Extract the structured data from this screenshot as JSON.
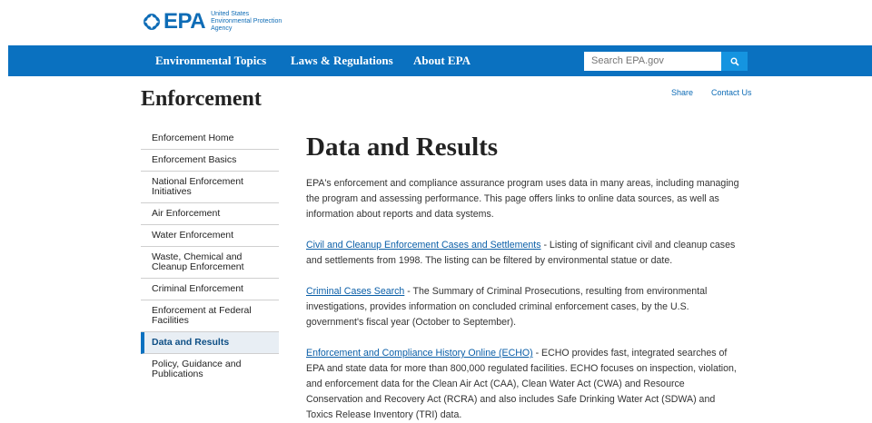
{
  "logo": {
    "text": "EPA",
    "sub": [
      "United States",
      "Environmental Protection",
      "Agency"
    ]
  },
  "nav": {
    "items": [
      "Environmental Topics",
      "Laws & Regulations",
      "About EPA"
    ],
    "search_placeholder": "Search EPA.gov",
    "search_icon": "search-icon"
  },
  "header": {
    "section_title": "Enforcement",
    "share": "Share",
    "contact": "Contact Us"
  },
  "sidebar": {
    "items": [
      {
        "label": "Enforcement Home"
      },
      {
        "label": "Enforcement Basics"
      },
      {
        "label": "National Enforcement Initiatives"
      },
      {
        "label": "Air Enforcement"
      },
      {
        "label": "Water Enforcement"
      },
      {
        "label": "Waste, Chemical and Cleanup Enforcement"
      },
      {
        "label": "Criminal Enforcement"
      },
      {
        "label": "Enforcement at Federal Facilities"
      },
      {
        "label": "Data and Results",
        "active": true
      },
      {
        "label": "Policy, Guidance and Publications"
      }
    ]
  },
  "main": {
    "title": "Data and Results",
    "intro": "EPA's enforcement and compliance assurance program uses data in many areas, including managing the program and assessing performance. This page offers links to online data sources, as well as information about reports and data systems.",
    "entries": [
      {
        "link": "Civil and Cleanup Enforcement Cases and Settlements",
        "text": " - Listing of significant civil and cleanup cases and settlements from 1998. The listing can be filtered by environmental statue or date."
      },
      {
        "link": "Criminal Cases Search",
        "text": " - The Summary of Criminal Prosecutions, resulting from environmental investigations, provides information on concluded criminal enforcement cases, by the U.S. government's fiscal year (October to September)."
      },
      {
        "link": "Enforcement and Compliance History Online (ECHO)",
        "text": " - ECHO provides fast, integrated searches of EPA and state data for more than 800,000 regulated facilities. ECHO focuses on inspection, violation, and enforcement data for the Clean Air Act (CAA), Clean Water Act (CWA) and Resource Conservation and Recovery Act (RCRA) and also includes Safe Drinking Water Act (SDWA) and Toxics Release Inventory (TRI) data."
      }
    ]
  },
  "colors": {
    "brand_blue": "#0a71c0",
    "search_button": "#1594e0",
    "link": "#0b5fa8"
  }
}
